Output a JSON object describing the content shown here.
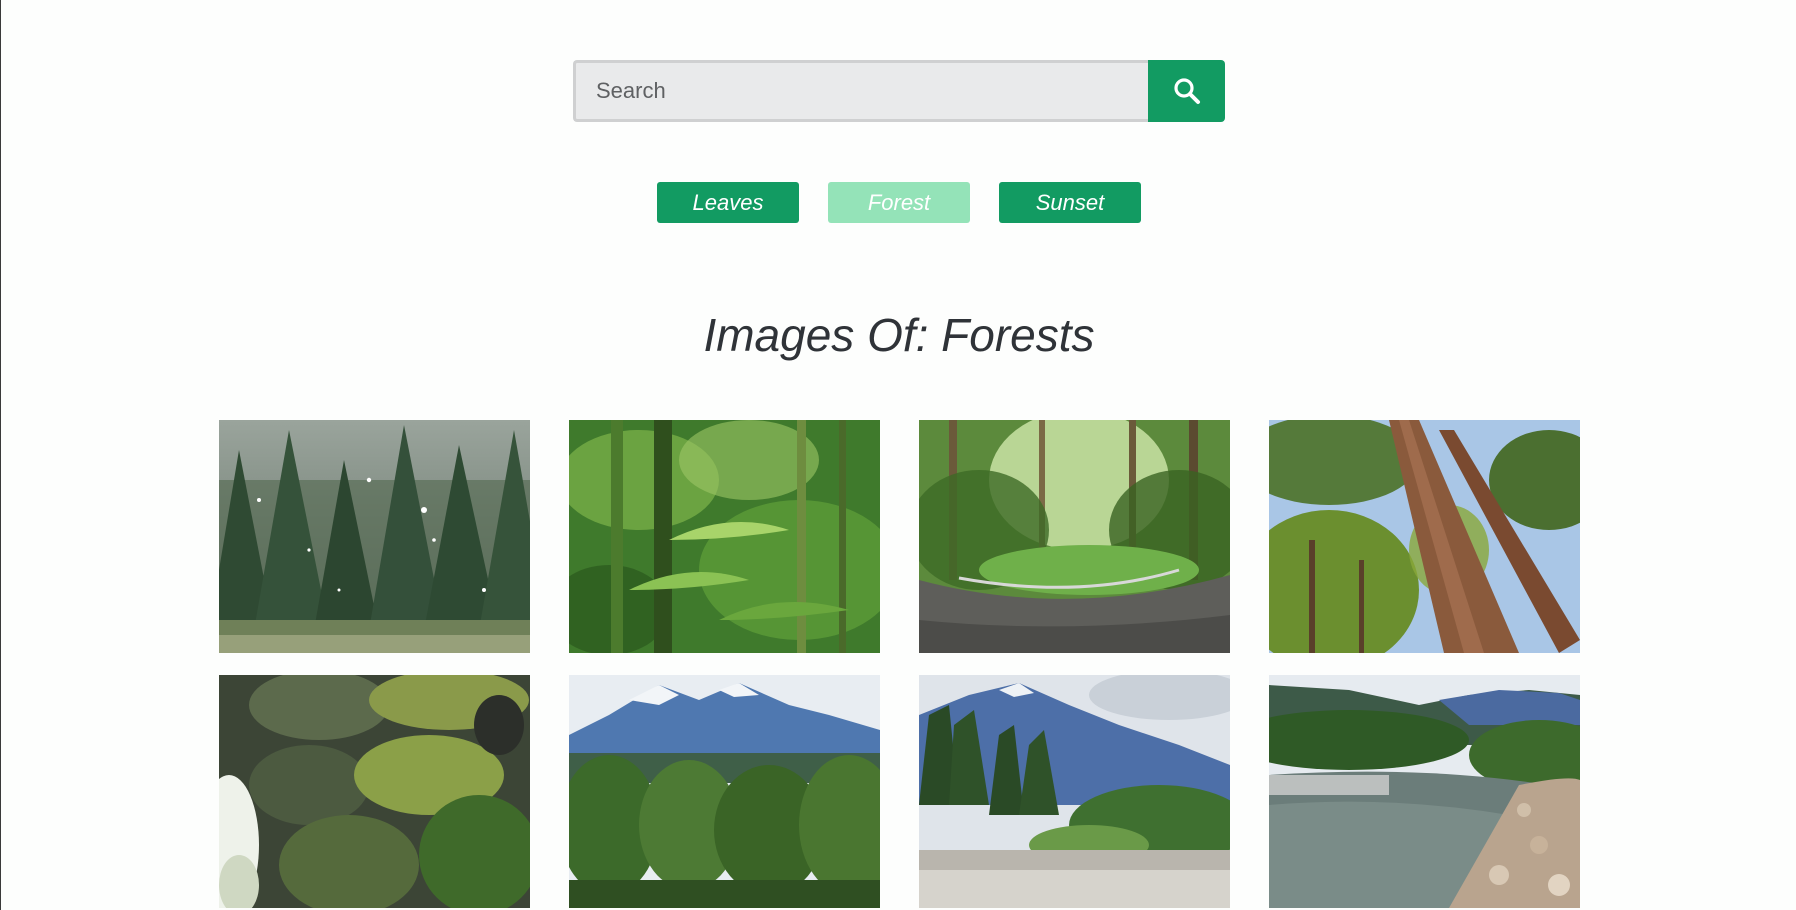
{
  "search": {
    "placeholder": "Search",
    "value": "",
    "button_icon": "search-icon",
    "accent": "#129b62"
  },
  "tags": [
    {
      "label": "Leaves",
      "active": false
    },
    {
      "label": "Forest",
      "active": true
    },
    {
      "label": "Sunset",
      "active": false
    }
  ],
  "colors": {
    "tag": "#129b62",
    "tag_active": "#94e3b8",
    "heading": "#2f3338",
    "background": "#fdfefd"
  },
  "gallery": {
    "heading": "Images Of: Forests",
    "images": [
      {
        "scene": "snowy-pine-forest"
      },
      {
        "scene": "bamboo-leaves"
      },
      {
        "scene": "forest-road"
      },
      {
        "scene": "tall-tree-trunks"
      },
      {
        "scene": "mossy-rocks"
      },
      {
        "scene": "mountain-forest"
      },
      {
        "scene": "mountain-valley-river"
      },
      {
        "scene": "river-rocky-shore"
      }
    ]
  }
}
